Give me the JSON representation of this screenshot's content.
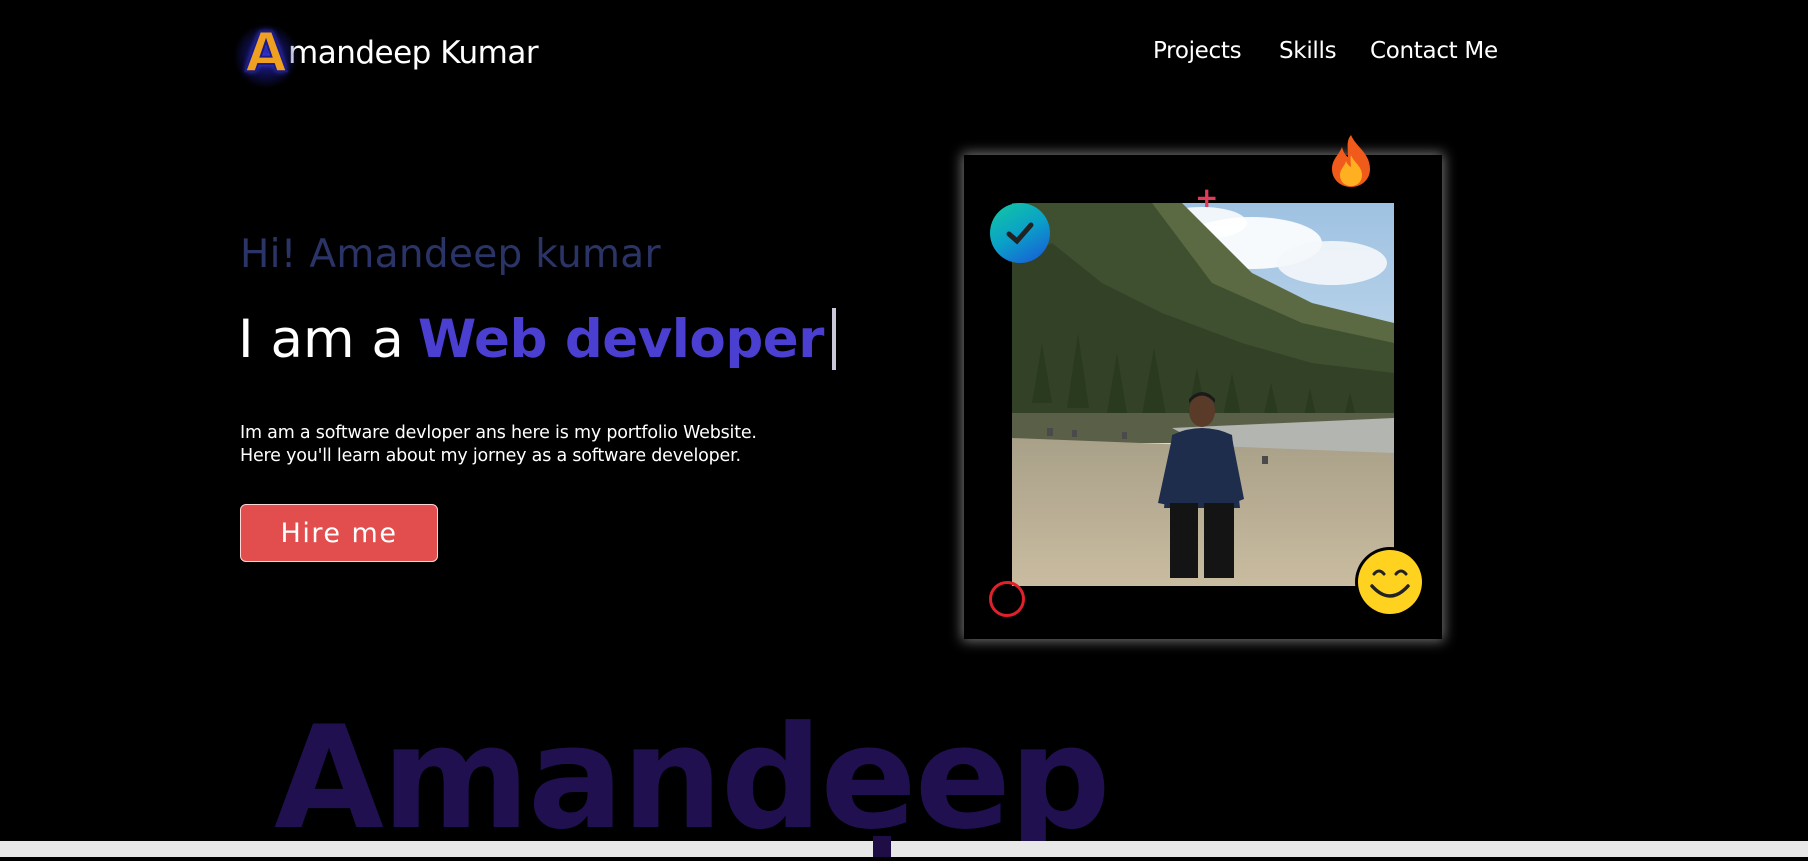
{
  "header": {
    "logo_letter": "A",
    "logo_name": "mandeep Kumar",
    "nav": [
      "Projects",
      "Skills",
      "Contact Me"
    ]
  },
  "hero": {
    "greeting": "Hi! Amandeep kumar",
    "headline_prefix": "I am a",
    "headline_role": "Web devloper",
    "intro_lines": [
      "Im am a software devloper ans here is my portfolio Website.",
      "Here you'll learn about my jorney as a software developer."
    ],
    "hire_label": "Hire me"
  },
  "photo_card": {
    "decorations": [
      "check-icon",
      "plus-icon",
      "fire-icon",
      "ring-icon",
      "smile-icon"
    ]
  },
  "background_word": "Amandeep",
  "colors": {
    "greeting": "#2b3466",
    "role": "#4a3fd0",
    "hire_button": "#e24e4e",
    "background_word": "#211050"
  }
}
